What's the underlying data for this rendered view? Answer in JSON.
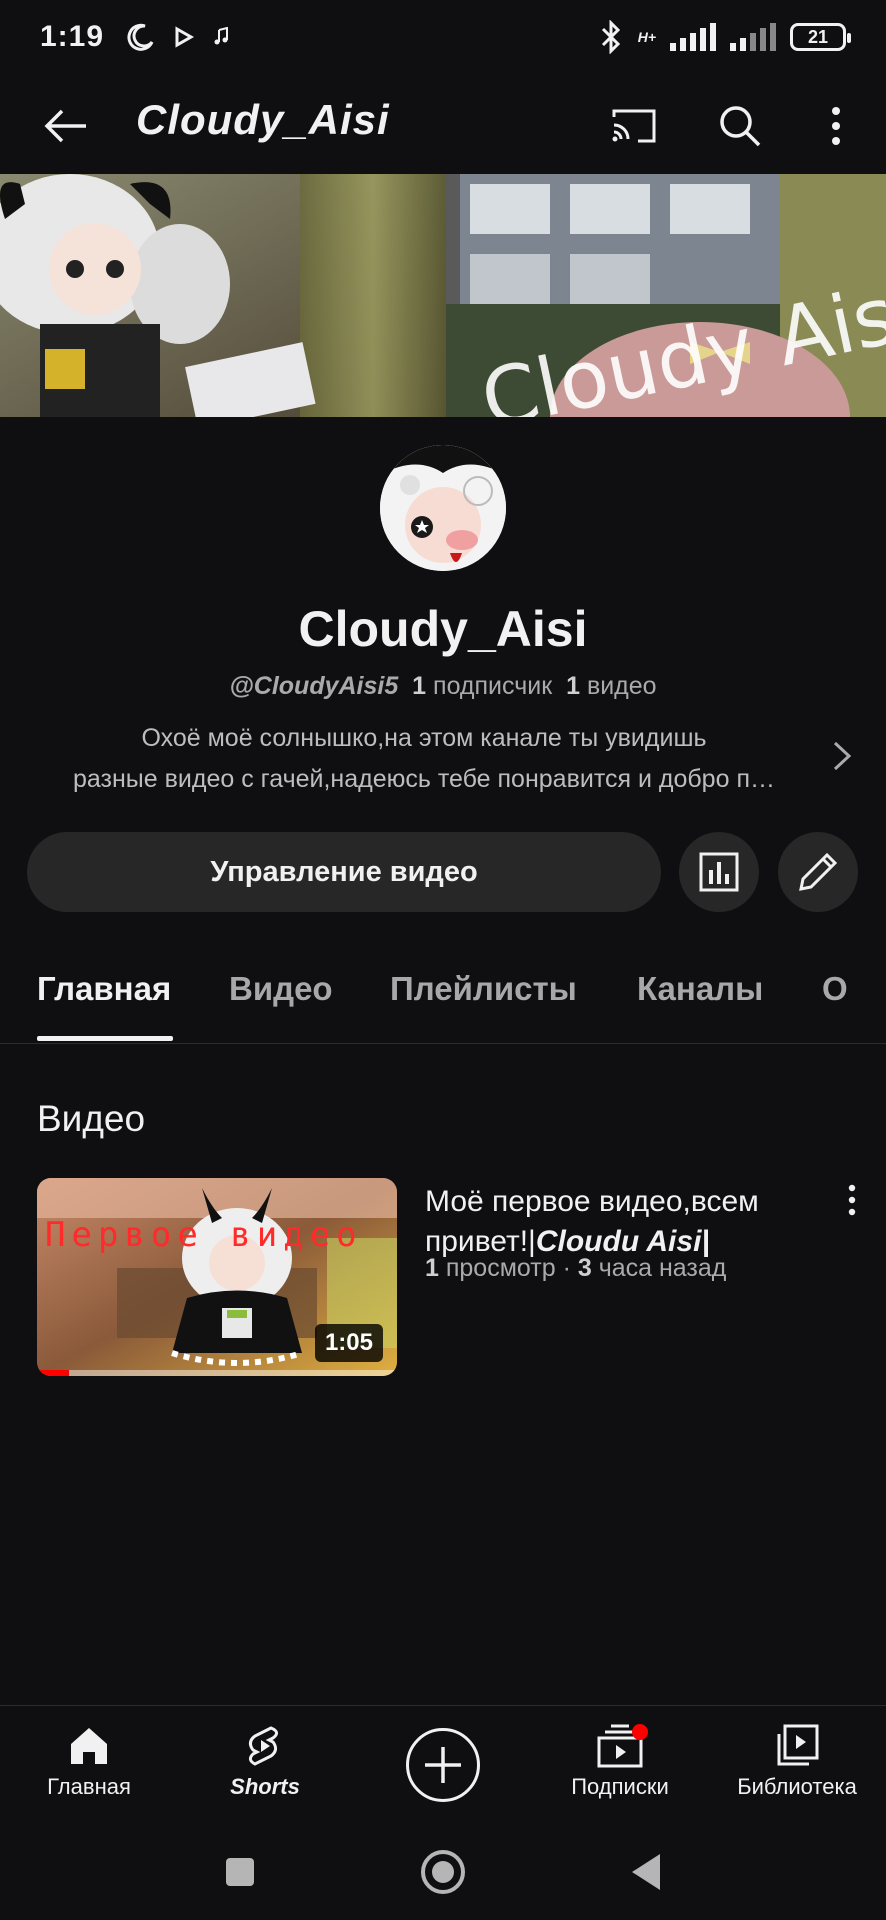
{
  "status_bar": {
    "time": "1:19",
    "network_label": "H+",
    "battery": "21"
  },
  "app_bar": {
    "title": "Cloudy_Aisi",
    "icons": [
      "back-arrow-icon",
      "cast-icon",
      "search-icon",
      "more-vert-icon"
    ]
  },
  "channel": {
    "name": "Cloudy_Aisi",
    "handle": "@CloudyAisi5",
    "subscribers_count": "1",
    "subscribers_label": "подписчик",
    "videos_count": "1",
    "videos_label": "видео",
    "description_line1": "Охоё моё солнышко,на этом канале ты увидишь",
    "description_line2": "разные видео с гачей,надеюсь тебе понравится и добро п…",
    "banner_text": "Cloudy Aisi"
  },
  "actions": {
    "manage_label": "Управление видео",
    "analytics_icon": "analytics-icon",
    "edit_icon": "edit-pencil-icon"
  },
  "tabs": [
    {
      "label": "Главная",
      "active": true
    },
    {
      "label": "Видео",
      "active": false
    },
    {
      "label": "Плейлисты",
      "active": false
    },
    {
      "label": "Каналы",
      "active": false
    },
    {
      "label": "О",
      "active": false
    }
  ],
  "section": {
    "title": "Видео"
  },
  "video": {
    "title_plain": "Моё первое видео,всем привет!|",
    "title_styled": "Cloudu Aisi|",
    "thumbnail_text": "Первое видео",
    "duration": "1:05",
    "views_count": "1",
    "views_label": "просмотр",
    "separator": "·",
    "age_count": "3",
    "age_label": "часа назад",
    "watched_fraction": 0.09
  },
  "bottom_nav": [
    {
      "label": "Главная",
      "icon": "home-icon"
    },
    {
      "label": "Shorts",
      "icon": "shorts-icon"
    },
    {
      "label": "",
      "icon": "create-plus-icon"
    },
    {
      "label": "Подписки",
      "icon": "subscriptions-icon"
    },
    {
      "label": "Библиотека",
      "icon": "library-icon"
    }
  ],
  "colors": {
    "background": "#0f0f12",
    "chip": "#272727",
    "accent_red": "#ff0000",
    "text_secondary": "#aaaaaa"
  }
}
